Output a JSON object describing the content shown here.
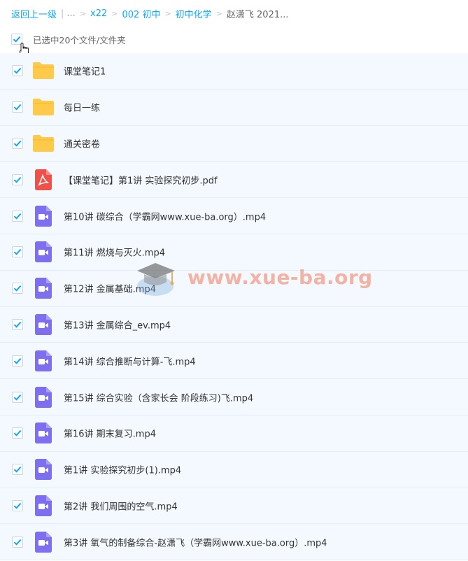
{
  "breadcrumb": {
    "back": "返回上一级",
    "ellipsis": "...",
    "items": [
      "x22",
      "002 初中",
      "初中化学"
    ],
    "current": "赵潇飞 2021..."
  },
  "selection": {
    "text": "已选中20个文件/文件夹",
    "checked": true
  },
  "files": [
    {
      "name": "课堂笔记1",
      "type": "folder",
      "checked": true
    },
    {
      "name": "每日一练",
      "type": "folder",
      "checked": true
    },
    {
      "name": "通关密卷",
      "type": "folder",
      "checked": true
    },
    {
      "name": "【课堂笔记】第1讲 实验探究初步.pdf",
      "type": "pdf",
      "checked": true
    },
    {
      "name": "第10讲 碳综合（学霸网www.xue-ba.org）.mp4",
      "type": "video",
      "checked": true
    },
    {
      "name": "第11讲 燃烧与灭火.mp4",
      "type": "video",
      "checked": true
    },
    {
      "name": "第12讲 金属基础.mp4",
      "type": "video",
      "checked": true
    },
    {
      "name": "第13讲 金属综合_ev.mp4",
      "type": "video",
      "checked": true
    },
    {
      "name": "第14讲 综合推断与计算-飞.mp4",
      "type": "video",
      "checked": true
    },
    {
      "name": "第15讲 综合实验（含家长会 阶段练习)飞.mp4",
      "type": "video",
      "checked": true
    },
    {
      "name": "第16讲 期末复习.mp4",
      "type": "video",
      "checked": true
    },
    {
      "name": "第1讲 实验探究初步(1).mp4",
      "type": "video",
      "checked": true
    },
    {
      "name": "第2讲 我们周围的空气.mp4",
      "type": "video",
      "checked": true
    },
    {
      "name": "第3讲 氧气的制备综合-赵潇飞（学霸网www.xue-ba.org）.mp4",
      "type": "video",
      "checked": true
    }
  ],
  "watermark": {
    "text": "www.xue-ba.org"
  },
  "colors": {
    "link": "#09aaff",
    "check": "#09aaff",
    "row_bg": "#f3f9fe",
    "folder": "#ffc94a",
    "pdf": "#f0504a",
    "video": "#7d6ff0"
  }
}
